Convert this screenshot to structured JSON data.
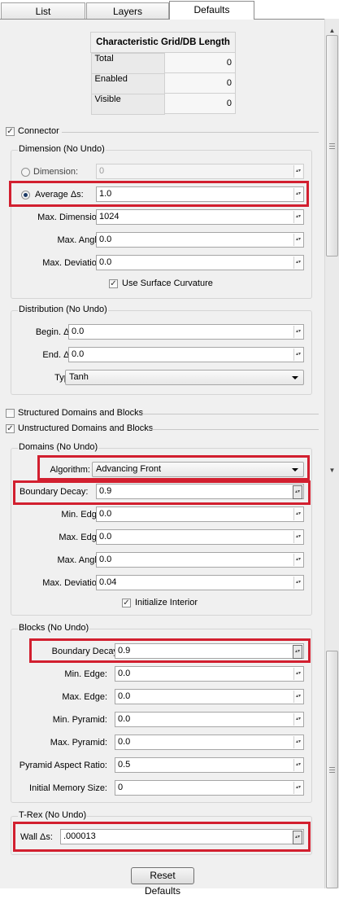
{
  "tabs": [
    {
      "label": "List"
    },
    {
      "label": "Layers"
    },
    {
      "label": "Defaults"
    }
  ],
  "stats_table": {
    "header": "Characteristic Grid/DB Length",
    "rows": [
      {
        "label": "Total",
        "value": "0"
      },
      {
        "label": "Enabled",
        "value": "0"
      },
      {
        "label": "Visible",
        "value": "0"
      }
    ]
  },
  "connector": {
    "checkbox_label": "Connector",
    "checked": true,
    "dimension_group": {
      "title": "Dimension (No Undo)",
      "dimension_radio_label": "Dimension:",
      "dimension_value": "0",
      "average_radio_label": "Average Δs:",
      "average_value": "1.0",
      "max_dimension_label": "Max. Dimension:",
      "max_dimension_value": "1024",
      "max_angle_label": "Max. Angle:",
      "max_angle_value": "0.0",
      "max_deviation_label": "Max. Deviation:",
      "max_deviation_value": "0.0",
      "surface_curvature_label": "Use Surface Curvature",
      "surface_curvature_checked": true
    },
    "distribution_group": {
      "title": "Distribution (No Undo)",
      "begin_label": "Begin. Δs:",
      "begin_value": "0.0",
      "end_label": "End. Δs:",
      "end_value": "0.0",
      "type_label": "Type:",
      "type_value": "Tanh"
    }
  },
  "structured": {
    "label": "Structured Domains and Blocks",
    "checked": false
  },
  "unstructured": {
    "label": "Unstructured Domains and Blocks",
    "checked": true,
    "domains_group": {
      "title": "Domains (No Undo)",
      "algorithm_label": "Algorithm:",
      "algorithm_value": "Advancing Front",
      "boundary_decay_label": "Boundary Decay:",
      "boundary_decay_value": "0.9",
      "min_edge_label": "Min. Edge:",
      "min_edge_value": "0.0",
      "max_edge_label": "Max. Edge:",
      "max_edge_value": "0.0",
      "max_angle_label": "Max. Angle:",
      "max_angle_value": "0.0",
      "max_deviation_label": "Max. Deviation:",
      "max_deviation_value": "0.04",
      "initialize_interior_label": "Initialize Interior",
      "initialize_interior_checked": true
    },
    "blocks_group": {
      "title": "Blocks (No Undo)",
      "boundary_decay_label": "Boundary Decay:",
      "boundary_decay_value": "0.9",
      "min_edge_label": "Min. Edge:",
      "min_edge_value": "0.0",
      "max_edge_label": "Max. Edge:",
      "max_edge_value": "0.0",
      "min_pyramid_label": "Min. Pyramid:",
      "min_pyramid_value": "0.0",
      "max_pyramid_label": "Max. Pyramid:",
      "max_pyramid_value": "0.0",
      "pyramid_aspect_label": "Pyramid Aspect Ratio:",
      "pyramid_aspect_value": "0.5",
      "initial_memory_label": "Initial Memory Size:",
      "initial_memory_value": "0"
    },
    "trex_group": {
      "title": "T-Rex (No Undo)",
      "wall_label": "Wall Δs:",
      "wall_value": ".000013"
    }
  },
  "reset_button_label": "Reset Defaults",
  "highlight_color": "#d21f2f"
}
